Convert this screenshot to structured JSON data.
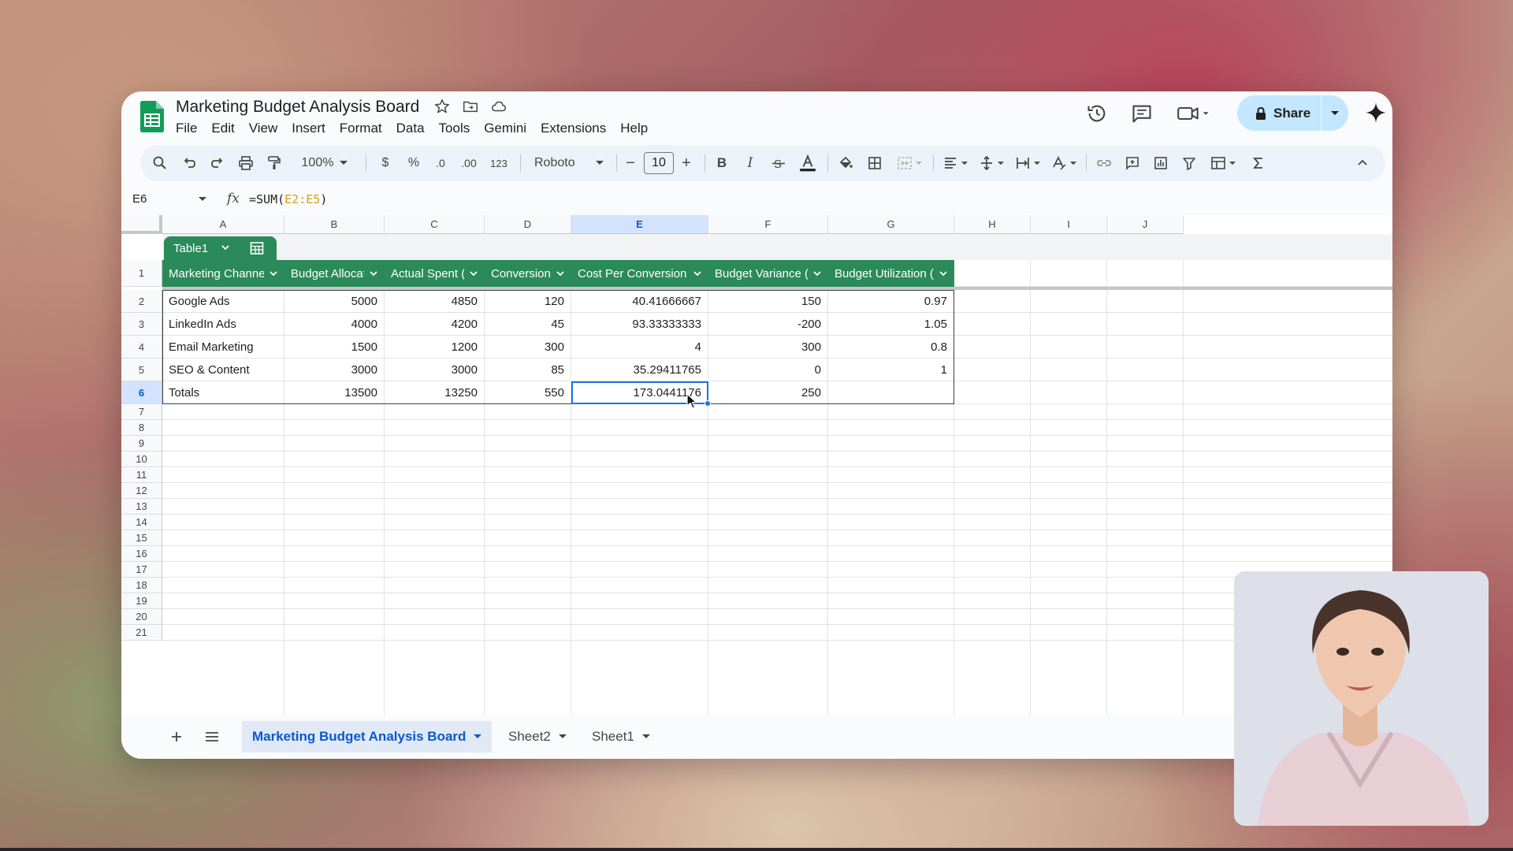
{
  "app": {
    "doc_title": "Marketing Budget Analysis Board",
    "menu": [
      "File",
      "Edit",
      "View",
      "Insert",
      "Format",
      "Data",
      "Tools",
      "Gemini",
      "Extensions",
      "Help"
    ],
    "share_label": "Share"
  },
  "toolbar": {
    "zoom": "100%",
    "currency": "$",
    "percent": "%",
    "dec_decrease": ".0",
    "dec_increase": ".00",
    "number_format": "123",
    "font": "Roboto",
    "font_size": "10",
    "bold": "B",
    "italic": "I"
  },
  "formula_bar": {
    "cell_ref": "E6",
    "fx": "fx",
    "formula_prefix": "=SUM(",
    "formula_range": "E2:E5",
    "formula_suffix": ")"
  },
  "grid": {
    "columns": [
      "A",
      "B",
      "C",
      "D",
      "E",
      "F",
      "G",
      "H",
      "I",
      "J"
    ],
    "selected_column": "E",
    "rows": [
      "1",
      "2",
      "3",
      "4",
      "5",
      "6",
      "7",
      "8",
      "9",
      "10",
      "11",
      "12",
      "13",
      "14",
      "15",
      "16",
      "17",
      "18",
      "19",
      "20",
      "21"
    ],
    "selected_row": "6"
  },
  "table": {
    "name": "Table1",
    "headers": [
      "Marketing Channel",
      "Budget Allocated",
      "Actual Spent ($)",
      "Conversions",
      "Cost Per Conversion ($)",
      "Budget Variance ($)",
      "Budget Utilization (%)"
    ],
    "rows": [
      [
        "Google Ads",
        "5000",
        "4850",
        "120",
        "40.41666667",
        "150",
        "0.97"
      ],
      [
        "LinkedIn Ads",
        "4000",
        "4200",
        "45",
        "93.33333333",
        "-200",
        "1.05"
      ],
      [
        "Email Marketing",
        "1500",
        "1200",
        "300",
        "4",
        "300",
        "0.8"
      ],
      [
        "SEO & Content",
        "3000",
        "3000",
        "85",
        "35.29411765",
        "0",
        "1"
      ],
      [
        "Totals",
        "13500",
        "13250",
        "550",
        "173.0441176",
        "250",
        ""
      ]
    ]
  },
  "sheets": {
    "tabs": [
      "Marketing Budget Analysis Board",
      "Sheet2",
      "Sheet1"
    ],
    "active": "Marketing Budget Analysis Board"
  },
  "colors": {
    "table_header": "#2b8a5a",
    "selection": "#1a73e8",
    "share_bg": "#c2e7ff",
    "toolbar_bg": "#edf2fa"
  }
}
